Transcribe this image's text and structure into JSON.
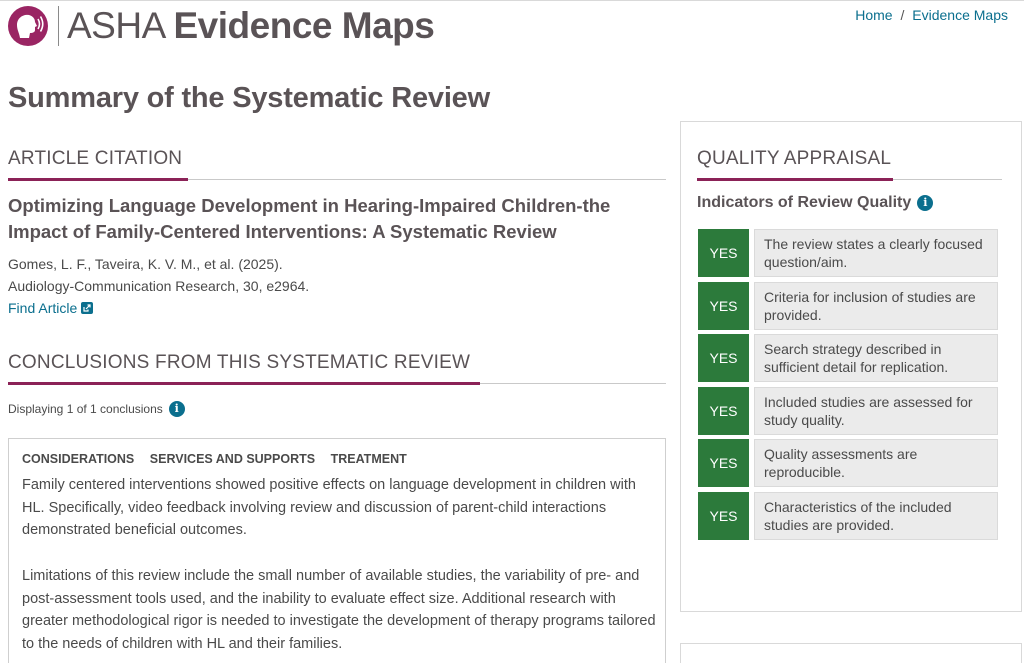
{
  "header": {
    "logo_light": "ASHA",
    "logo_bold": "Evidence Maps",
    "breadcrumb": {
      "home": "Home",
      "separator": "/",
      "current": "Evidence Maps"
    }
  },
  "page_title": "Summary of the Systematic Review",
  "article_citation": {
    "heading": "ARTICLE CITATION",
    "title": "Optimizing Language Development in Hearing-Impaired Children-the Impact of Family-Centered Interventions: A Systematic Review",
    "authors_line": "Gomes, L. F., Taveira, K. V. M., et al. (2025).",
    "journal_line": "Audiology-Communication Research, 30, e2964.",
    "find_article": "Find Article"
  },
  "conclusions": {
    "heading": "CONCLUSIONS FROM THIS SYSTEMATIC REVIEW",
    "displaying": "Displaying 1 of 1 conclusions",
    "tags": [
      "CONSIDERATIONS",
      "SERVICES AND SUPPORTS",
      "TREATMENT"
    ],
    "paragraph_1": "Family centered interventions showed positive effects on language development in children with HL. Specifically, video feedback involving review and discussion of parent-child interactions demonstrated beneficial outcomes.",
    "paragraph_2": "Limitations of this review include the small number of available studies, the variability of pre- and post-assessment tools used, and the inability to evaluate effect size. Additional research with greater methodological rigor is needed to investigate the development of therapy programs tailored to the needs of children with HL and their families."
  },
  "quality_appraisal": {
    "heading": "QUALITY APPRAISAL",
    "subheading": "Indicators of Review Quality",
    "indicators": [
      {
        "value": "YES",
        "text": "The review states a clearly focused question/aim."
      },
      {
        "value": "YES",
        "text": "Criteria for inclusion of studies are provided."
      },
      {
        "value": "YES",
        "text": "Search strategy described in sufficient detail for replication."
      },
      {
        "value": "YES",
        "text": "Included studies are assessed for study quality."
      },
      {
        "value": "YES",
        "text": "Quality assessments are reproducible."
      },
      {
        "value": "YES",
        "text": "Characteristics of the included studies are provided."
      }
    ]
  },
  "colors": {
    "brand_plum": "#8b2257",
    "link_teal": "#0b6f8e",
    "yes_green": "#2c7a3b"
  },
  "icons": {
    "logo": "asha-profile-logo-icon",
    "info": "info-icon",
    "external_link": "external-link-icon"
  }
}
